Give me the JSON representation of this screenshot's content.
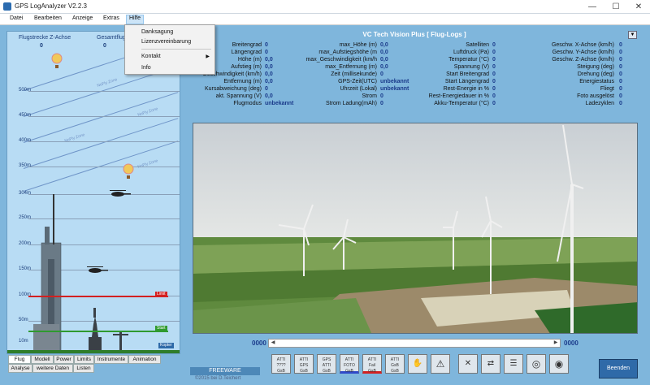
{
  "window": {
    "title": "GPS LogAnalyzer V2.2.3",
    "minimize": "—",
    "maximize": "☐",
    "close": "✕"
  },
  "menu": {
    "items": [
      "Datei",
      "Bearbeiten",
      "Anzeige",
      "Extras",
      "Hilfe"
    ],
    "dropdown": {
      "items": [
        "Danksagung",
        "Lizenzvereinbarung",
        "Kontakt",
        "Info"
      ],
      "submenu_arrow": "▶"
    }
  },
  "left_panel": {
    "label_left": "Flugstrecke Z-Achse",
    "label_right": "Gesamtflugstrec",
    "value_left": "0",
    "value_right": "0",
    "altitude_ticks": [
      "500m",
      "450m",
      "400m",
      "350m",
      "304m",
      "250m",
      "200m",
      "150m",
      "100m",
      "50m",
      "10m"
    ],
    "cloud_text": "NoFly Zone",
    "marker_red": "Limit",
    "marker_green": "Start",
    "marker_blue": "Kopter"
  },
  "tabs_row1": [
    "Flug",
    "Modell",
    "Power",
    "Limits",
    "Instrumente",
    "Animation"
  ],
  "tabs_row2": [
    "Analyse",
    "weitere Daten",
    "Listen"
  ],
  "right_panel": {
    "title": "VC Tech Vision Plus [ Flug-Logs ]",
    "dropdown_button": "▼",
    "col1": [
      {
        "label": "Breitengrad",
        "value": "0"
      },
      {
        "label": "Längengrad",
        "value": "0"
      },
      {
        "label": "Höhe (m)",
        "value": "0,0"
      },
      {
        "label": "Aufstieg (m)",
        "value": "0,0"
      },
      {
        "label": "Geschwindigkeit (km/h)",
        "value": "0,0"
      },
      {
        "label": "Entfernung (m)",
        "value": "0,0"
      },
      {
        "label": "Kursabweichung (deg)",
        "value": "0"
      },
      {
        "label": "akt. Spannung (V)",
        "value": "0,0"
      },
      {
        "label": "Flugmodus",
        "value": "unbekannt"
      }
    ],
    "col2": [
      {
        "label": "max_Höhe (m)",
        "value": "0,0"
      },
      {
        "label": "max_Aufstiegshöhe (m",
        "value": "0,0"
      },
      {
        "label": "max_Geschwindigkeit (km/h",
        "value": "0,0"
      },
      {
        "label": "max_Entfernung (m)",
        "value": "0,0"
      },
      {
        "label": "Zeit (millisekunde)",
        "value": "0"
      },
      {
        "label": "GPS-Zeit(UTC)",
        "value": "unbekannt"
      },
      {
        "label": "Uhrzeit (Lokal)",
        "value": "unbekannt"
      },
      {
        "label": "Strom",
        "value": "0"
      },
      {
        "label": "Strom Ladung(mAh)",
        "value": "0"
      }
    ],
    "col3": [
      {
        "label": "Satelliten",
        "value": "0"
      },
      {
        "label": "Luftdruck (Pa)",
        "value": "0"
      },
      {
        "label": "Temperatur (°C)",
        "value": "0"
      },
      {
        "label": "Spannung (V)",
        "value": "0"
      },
      {
        "label": "Start Breitengrad",
        "value": "0"
      },
      {
        "label": "Start Längengrad",
        "value": "0"
      },
      {
        "label": "Rest-Energie in %",
        "value": "0"
      },
      {
        "label": "Rest-Energiedauer in %",
        "value": "0"
      },
      {
        "label": "Akku-Temperatur (°C)",
        "value": "0"
      }
    ],
    "col4": [
      {
        "label": "Geschw. X-Achse (km/h)",
        "value": "0"
      },
      {
        "label": "Geschw. Y-Achse (km/h)",
        "value": "0"
      },
      {
        "label": "Geschw. Z-Achse (km/h)",
        "value": "0"
      },
      {
        "label": "Steigung (deg)",
        "value": "0"
      },
      {
        "label": "Drehung (deg)",
        "value": "0"
      },
      {
        "label": "Energiestatus",
        "value": "0"
      },
      {
        "label": "Fliegt",
        "value": "0"
      },
      {
        "label": "Foto ausgelöst",
        "value": "0"
      },
      {
        "label": "Ladezyklen",
        "value": "0"
      }
    ]
  },
  "video": {
    "counter_left": "0000",
    "counter_right": "0000",
    "scroll_left": "◀",
    "scroll_right": "▶"
  },
  "toolbar": {
    "tools": [
      {
        "name": "atti-log-tool",
        "label": "ATTI\n????\nGsB"
      },
      {
        "name": "atti-gps-tool",
        "label": "ATTI\nGPS\nGsB"
      },
      {
        "name": "atti-tool",
        "label": "GPS\nATTI\nGsB"
      },
      {
        "name": "atti-foto-tool",
        "label": "ATTI\nFOTO\nGsB"
      },
      {
        "name": "fail-tool",
        "label": "ATTI\nFail\nGsB"
      },
      {
        "name": "atti-gsb-tool",
        "label": "ATTI\nGsB\nGsB"
      },
      {
        "name": "hand-tool",
        "label": "✋"
      },
      {
        "name": "warning-tool",
        "label": "⚠"
      },
      {
        "name": "clear-tool",
        "label": "✕"
      },
      {
        "name": "transfer-tool",
        "label": "⇄"
      },
      {
        "name": "list-tool",
        "label": "☰"
      },
      {
        "name": "target-tool",
        "label": "◎"
      },
      {
        "name": "target2-tool",
        "label": "◉"
      }
    ],
    "freeware": "FREEWARE",
    "copyright": "©2015 bei D.Teichert",
    "exit": "Beenden"
  },
  "colors": {
    "panel_bg": "#7fb6dc",
    "left_panel_bg": "#b8dcf4",
    "value_blue": "#1a3a8a",
    "limit_red": "#d32020",
    "start_green": "#2f9a2f",
    "kopter_blue": "#2f6aa8"
  }
}
